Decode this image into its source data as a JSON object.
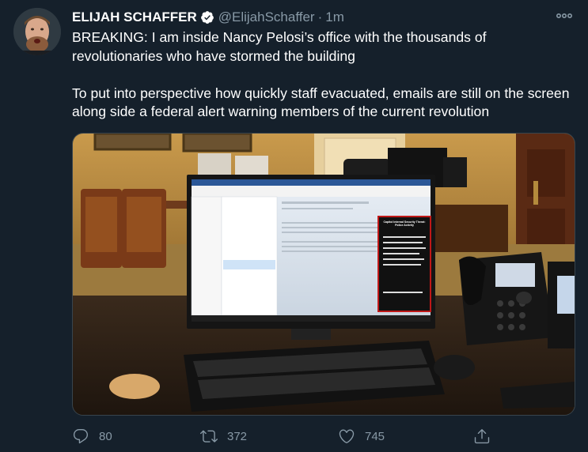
{
  "tweet": {
    "author_name": "ELIJAH SCHAFFER",
    "handle": "@ElijahSchaffer",
    "separator": "·",
    "time": "1m",
    "verified": true,
    "paragraphs": [
      "BREAKING: I am inside Nancy Pelosi’s office with the thousands of revolutionaries who have stormed the building",
      "To put into perspective how quickly staff evacuated, emails are still on the screen along side a federal alert warning members of the current revolution"
    ],
    "media": {
      "screen_alert_title": "Capitol Internal Security Threat: Police Activity"
    },
    "actions": {
      "reply_count": "80",
      "retweet_count": "372",
      "like_count": "745"
    }
  },
  "colors": {
    "background": "#15202b",
    "secondary_text": "#8899a6",
    "verified_badge": "#ffffff",
    "border": "#38444d"
  },
  "icons": [
    "verified-badge-icon",
    "more-options-icon",
    "reply-icon",
    "retweet-icon",
    "like-icon",
    "share-icon"
  ]
}
